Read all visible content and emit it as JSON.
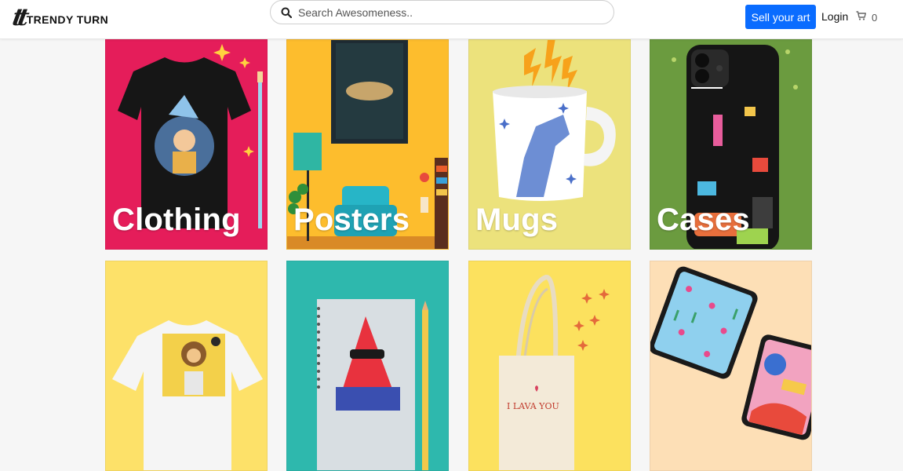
{
  "navbar": {
    "brand_mark": "tt",
    "brand_name": "TRENDY TURN",
    "search_placeholder": "Search Awesomeness..",
    "sell_label": "Sell your art",
    "login_label": "Login",
    "cart_count": "0",
    "icons": {
      "search": "search-icon",
      "cart": "cart-icon"
    }
  },
  "categories": [
    {
      "label": "Clothing",
      "bg": "#e51d5a"
    },
    {
      "label": "Posters",
      "bg": "#fdbd2d"
    },
    {
      "label": "Mugs",
      "bg": "#ece27c"
    },
    {
      "label": "Cases",
      "bg": "#6b9b3f"
    },
    {
      "label": "",
      "bg": "#fde169"
    },
    {
      "label": "",
      "bg": "#2eb8ad"
    },
    {
      "label": "",
      "bg": "#fce15e"
    },
    {
      "label": "",
      "bg": "#fddfb6"
    }
  ],
  "product_text": {
    "tote_bag_print": "I LAVA YOU"
  }
}
